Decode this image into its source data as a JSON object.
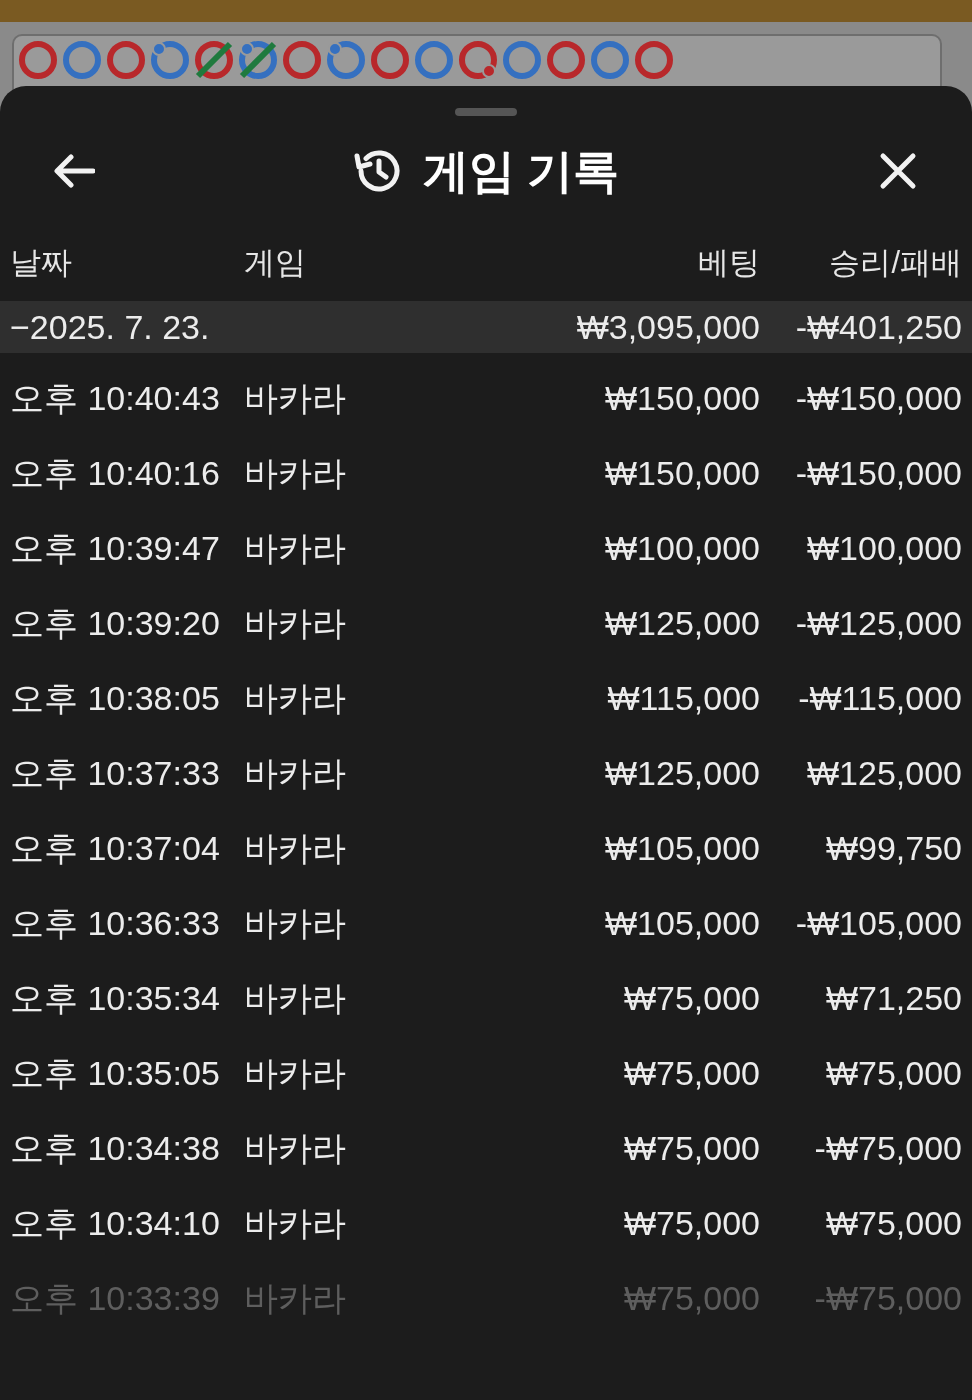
{
  "bead_road": [
    {
      "color": "#b8282b",
      "dot_top_left": false,
      "dot_bottom_right": false,
      "slash": false
    },
    {
      "color": "#3570c0",
      "dot_top_left": false,
      "dot_bottom_right": false,
      "slash": false
    },
    {
      "color": "#b8282b",
      "dot_top_left": false,
      "dot_bottom_right": false,
      "slash": false
    },
    {
      "color": "#3570c0",
      "dot_top_left": true,
      "dot_bottom_right": false,
      "slash": false
    },
    {
      "color": "#b8282b",
      "dot_top_left": false,
      "dot_bottom_right": false,
      "slash": true
    },
    {
      "color": "#3570c0",
      "dot_top_left": true,
      "dot_bottom_right": false,
      "slash": true
    },
    {
      "color": "#b8282b",
      "dot_top_left": false,
      "dot_bottom_right": false,
      "slash": false
    },
    {
      "color": "#3570c0",
      "dot_top_left": true,
      "dot_bottom_right": false,
      "slash": false
    },
    {
      "color": "#b8282b",
      "dot_top_left": false,
      "dot_bottom_right": false,
      "slash": false
    },
    {
      "color": "#3570c0",
      "dot_top_left": false,
      "dot_bottom_right": false,
      "slash": false
    },
    {
      "color": "#b8282b",
      "dot_top_left": false,
      "dot_bottom_right": true,
      "slash": false
    },
    {
      "color": "#3570c0",
      "dot_top_left": false,
      "dot_bottom_right": false,
      "slash": false
    },
    {
      "color": "#b8282b",
      "dot_top_left": false,
      "dot_bottom_right": false,
      "slash": false
    },
    {
      "color": "#3570c0",
      "dot_top_left": false,
      "dot_bottom_right": false,
      "slash": false
    },
    {
      "color": "#b8282b",
      "dot_top_left": false,
      "dot_bottom_right": false,
      "slash": false
    }
  ],
  "sheet": {
    "title": "게임 기록",
    "columns": [
      "날짜",
      "게임",
      "베팅",
      "승리/패배"
    ],
    "summary": {
      "date": "−2025. 7. 23.",
      "bet": "₩3,095,000",
      "result": "-₩401,250"
    },
    "rows": [
      {
        "time": "오후 10:40:43",
        "game": "바카라",
        "bet": "₩150,000",
        "result": "-₩150,000",
        "faded": false
      },
      {
        "time": "오후 10:40:16",
        "game": "바카라",
        "bet": "₩150,000",
        "result": "-₩150,000",
        "faded": false
      },
      {
        "time": "오후 10:39:47",
        "game": "바카라",
        "bet": "₩100,000",
        "result": "₩100,000",
        "faded": false
      },
      {
        "time": "오후 10:39:20",
        "game": "바카라",
        "bet": "₩125,000",
        "result": "-₩125,000",
        "faded": false
      },
      {
        "time": "오후 10:38:05",
        "game": "바카라",
        "bet": "₩115,000",
        "result": "-₩115,000",
        "faded": false
      },
      {
        "time": "오후 10:37:33",
        "game": "바카라",
        "bet": "₩125,000",
        "result": "₩125,000",
        "faded": false
      },
      {
        "time": "오후 10:37:04",
        "game": "바카라",
        "bet": "₩105,000",
        "result": "₩99,750",
        "faded": false
      },
      {
        "time": "오후 10:36:33",
        "game": "바카라",
        "bet": "₩105,000",
        "result": "-₩105,000",
        "faded": false
      },
      {
        "time": "오후 10:35:34",
        "game": "바카라",
        "bet": "₩75,000",
        "result": "₩71,250",
        "faded": false
      },
      {
        "time": "오후 10:35:05",
        "game": "바카라",
        "bet": "₩75,000",
        "result": "₩75,000",
        "faded": false
      },
      {
        "time": "오후 10:34:38",
        "game": "바카라",
        "bet": "₩75,000",
        "result": "-₩75,000",
        "faded": false
      },
      {
        "time": "오후 10:34:10",
        "game": "바카라",
        "bet": "₩75,000",
        "result": "₩75,000",
        "faded": false
      },
      {
        "time": "오후 10:33:39",
        "game": "바카라",
        "bet": "₩75,000",
        "result": "-₩75,000",
        "faded": true
      }
    ]
  }
}
